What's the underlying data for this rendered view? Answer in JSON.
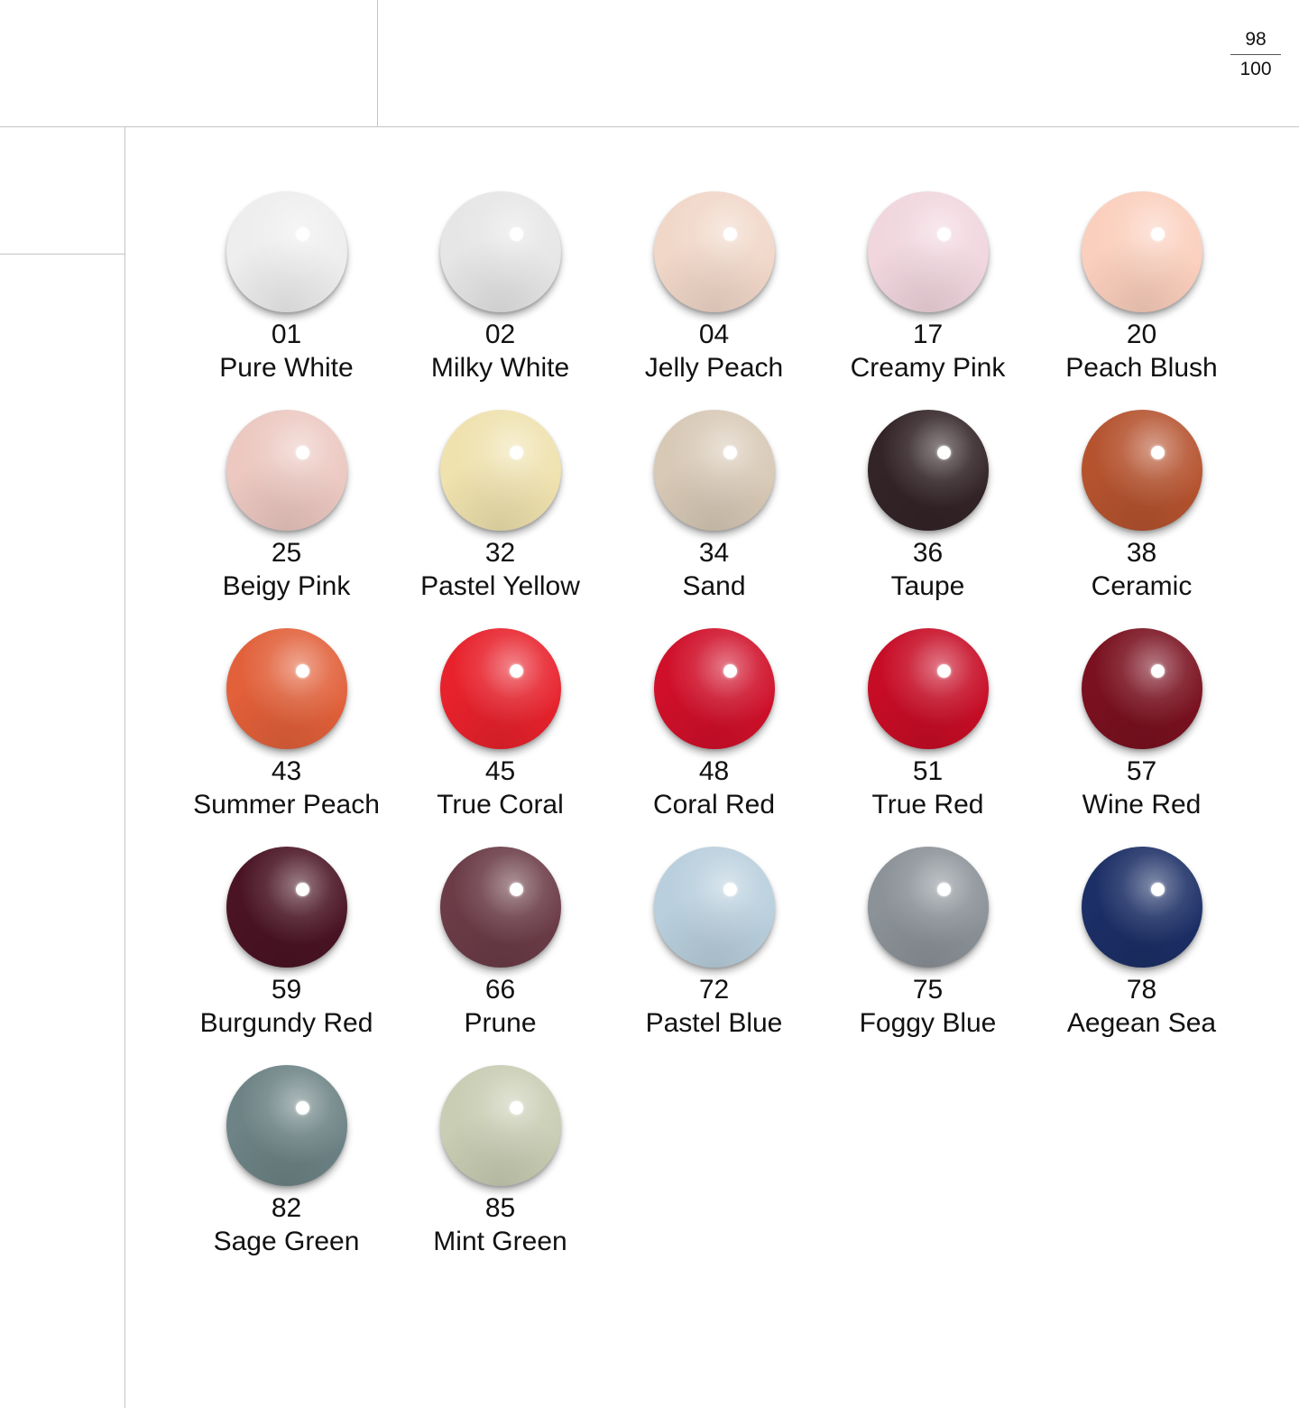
{
  "page": {
    "current": "98",
    "total": "100"
  },
  "swatches": [
    {
      "code": "01",
      "name": "Pure White",
      "color": "#eeeeee"
    },
    {
      "code": "02",
      "name": "Milky White",
      "color": "#e6e6e6"
    },
    {
      "code": "04",
      "name": "Jelly Peach",
      "color": "#f1d7c8"
    },
    {
      "code": "17",
      "name": "Creamy Pink",
      "color": "#f1d6de"
    },
    {
      "code": "20",
      "name": "Peach Blush",
      "color": "#fbcfbd"
    },
    {
      "code": "25",
      "name": "Beigy Pink",
      "color": "#ecc8c1"
    },
    {
      "code": "32",
      "name": "Pastel Yellow",
      "color": "#efe2ae"
    },
    {
      "code": "34",
      "name": "Sand",
      "color": "#d8c9b6"
    },
    {
      "code": "36",
      "name": "Taupe",
      "color": "#332427"
    },
    {
      "code": "38",
      "name": "Ceramic",
      "color": "#b5532f"
    },
    {
      "code": "43",
      "name": "Summer Peach",
      "color": "#e2603a"
    },
    {
      "code": "45",
      "name": "True Coral",
      "color": "#e8222c"
    },
    {
      "code": "48",
      "name": "Coral Red",
      "color": "#d0102a"
    },
    {
      "code": "51",
      "name": "True Red",
      "color": "#c70d26"
    },
    {
      "code": "57",
      "name": "Wine Red",
      "color": "#7a1120"
    },
    {
      "code": "59",
      "name": "Burgundy Red",
      "color": "#4a1424"
    },
    {
      "code": "66",
      "name": "Prune",
      "color": "#6b3c47"
    },
    {
      "code": "72",
      "name": "Pastel Blue",
      "color": "#b9cfdd"
    },
    {
      "code": "75",
      "name": "Foggy Blue",
      "color": "#8b9298"
    },
    {
      "code": "78",
      "name": "Aegean Sea",
      "color": "#1c2f66"
    },
    {
      "code": "82",
      "name": "Sage Green",
      "color": "#6d8385"
    },
    {
      "code": "85",
      "name": "Mint Green",
      "color": "#c9cdb3"
    }
  ]
}
